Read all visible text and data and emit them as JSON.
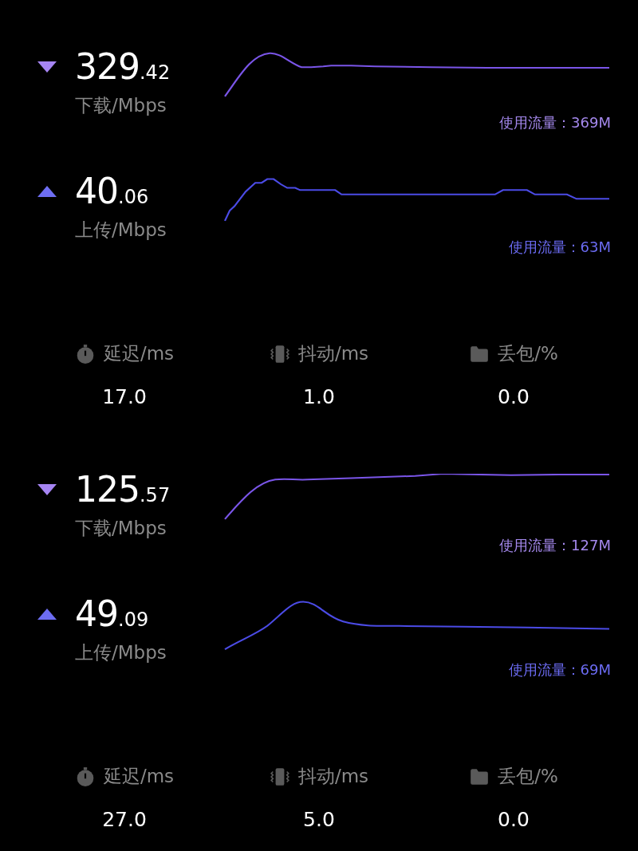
{
  "tests": [
    {
      "speeds": [
        {
          "kind": "download",
          "integer": "329",
          "decimal": ".42",
          "label": "下载/Mbps",
          "usage": "使用流量：369M"
        },
        {
          "kind": "upload",
          "integer": "40",
          "decimal": ".06",
          "label": "上传/Mbps",
          "usage": "使用流量：63M"
        }
      ],
      "stats": [
        {
          "kind": "latency",
          "label": "延迟/ms",
          "value": "17.0"
        },
        {
          "kind": "jitter",
          "label": "抖动/ms",
          "value": "1.0"
        },
        {
          "kind": "loss",
          "label": "丢包/%",
          "value": "0.0"
        }
      ]
    },
    {
      "speeds": [
        {
          "kind": "download",
          "integer": "125",
          "decimal": ".57",
          "label": "下载/Mbps",
          "usage": "使用流量：127M"
        },
        {
          "kind": "upload",
          "integer": "49",
          "decimal": ".09",
          "label": "上传/Mbps",
          "usage": "使用流量：69M"
        }
      ],
      "stats": [
        {
          "kind": "latency",
          "label": "延迟/ms",
          "value": "27.0"
        },
        {
          "kind": "jitter",
          "label": "抖动/ms",
          "value": "5.0"
        },
        {
          "kind": "loss",
          "label": "丢包/%",
          "value": "0.0"
        }
      ]
    }
  ]
}
